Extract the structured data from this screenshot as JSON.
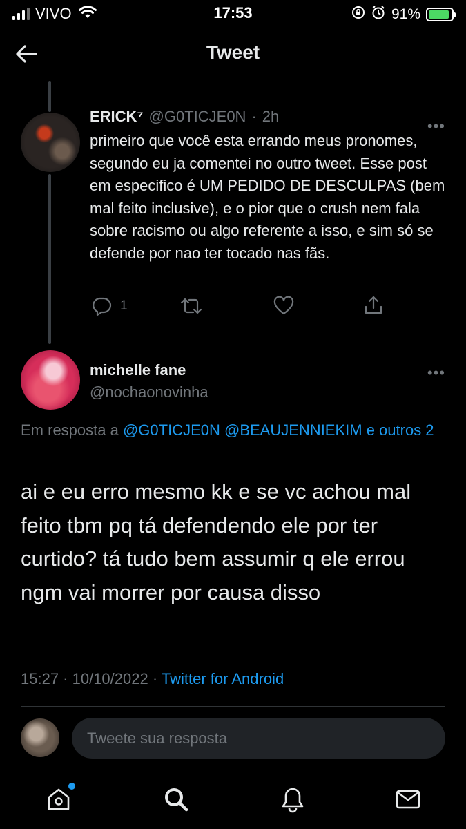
{
  "status_bar": {
    "carrier": "VIVO",
    "time": "17:53",
    "battery": "91%",
    "battery_level": 0.91
  },
  "header": {
    "title": "Tweet"
  },
  "parent_tweet": {
    "name": "ERICK⁷",
    "handle": "@G0TICJE0N",
    "separator": "·",
    "time": "2h",
    "text": "primeiro que você esta errando meus pronomes, segundo eu ja comentei no outro tweet. Esse post em especifico é UM PEDIDO DE DESCULPAS (bem mal feito inclusive), e o pior que o crush nem fala sobre racismo ou algo referente a isso, e sim só se defende por nao ter tocado nas fãs.",
    "reply_count": "1",
    "more": "•••"
  },
  "main_tweet": {
    "name": "michelle fane",
    "handle": "@nochaonovinha",
    "more": "•••",
    "reply_prefix": "Em resposta a",
    "reply_users": "@G0TICJE0N @BEAUJENNIEKIM e outros 2",
    "text": "ai e eu erro mesmo kk e se vc achou mal feito tbm pq tá defendendo ele por ter curtido? tá tudo bem assumir q ele errou ngm vai morrer por causa disso",
    "timestamp": "15:27 · 10/10/2022 ·",
    "source": "Twitter for Android"
  },
  "reply_bar": {
    "placeholder": "Tweete sua resposta"
  },
  "nav": {
    "items": [
      "home-icon",
      "search-icon",
      "notifications-icon",
      "messages-icon"
    ]
  }
}
